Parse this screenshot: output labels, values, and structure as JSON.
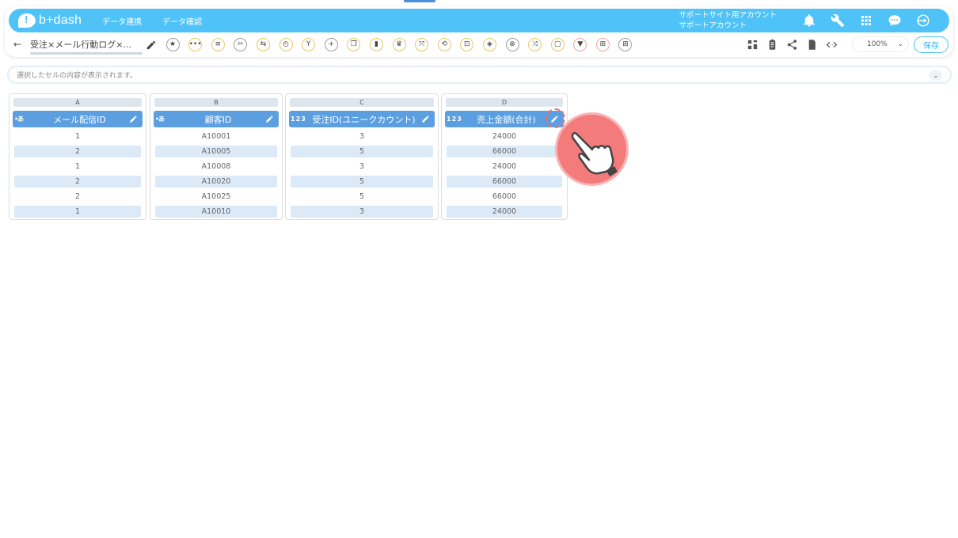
{
  "app": {
    "logo_text": "b+dash",
    "nav": [
      "データ連携",
      "データ確認"
    ],
    "account_line1": "サポートサイト用アカウント",
    "account_line2": "サポートアカウント"
  },
  "header_icons": [
    "bell-icon",
    "wrench-icon",
    "grid-icon",
    "chat-icon",
    "logout-icon"
  ],
  "toolbar": {
    "back_label": "←",
    "doc_title": "受注×メール行動ログ×...",
    "tool_buttons": [
      {
        "name": "star-icon",
        "glyph": "★",
        "tone": "g"
      },
      {
        "name": "more-icon",
        "glyph": "•••",
        "tone": "y"
      },
      {
        "name": "list-icon",
        "glyph": "≡",
        "tone": "y"
      },
      {
        "name": "scissors-icon",
        "glyph": "✂",
        "tone": "g"
      },
      {
        "name": "merge-icon",
        "glyph": "⇆",
        "tone": "y"
      },
      {
        "name": "timer-icon",
        "glyph": "◴",
        "tone": "y"
      },
      {
        "name": "branch-icon",
        "glyph": "Y",
        "tone": "y"
      },
      {
        "name": "plus-icon",
        "glyph": "+",
        "tone": "g"
      },
      {
        "name": "copy-icon",
        "glyph": "❐",
        "tone": "y"
      },
      {
        "name": "trash-icon",
        "glyph": "▮",
        "tone": "y"
      },
      {
        "name": "crown-icon",
        "glyph": "♛",
        "tone": "y"
      },
      {
        "name": "expand-icon",
        "glyph": "⤧",
        "tone": "y"
      },
      {
        "name": "repeat-icon",
        "glyph": "⟲",
        "tone": "y"
      },
      {
        "name": "lock-icon",
        "glyph": "⊡",
        "tone": "y"
      },
      {
        "name": "box-icon",
        "glyph": "◈",
        "tone": "y"
      },
      {
        "name": "cancel-icon",
        "glyph": "⊗",
        "tone": "g"
      },
      {
        "name": "shuffle-icon",
        "glyph": "⤨",
        "tone": "y"
      },
      {
        "name": "frame-icon",
        "glyph": "▢",
        "tone": "y"
      },
      {
        "name": "filter-icon",
        "glyph": "▼",
        "tone": "r"
      },
      {
        "name": "pivot-icon",
        "glyph": "⊞",
        "tone": "r"
      },
      {
        "name": "table-icon",
        "glyph": "⊞",
        "tone": "g"
      }
    ],
    "right_icons": [
      "flow-icon",
      "clipboard-icon",
      "share-icon",
      "history-icon",
      "code-icon"
    ],
    "zoom_value": "100%",
    "zoom_caret": "⌄",
    "save_label": "保存"
  },
  "cellbar": {
    "placeholder": "選択したセルの内容が表示されます。",
    "toggle": "⌄"
  },
  "columns": [
    {
      "letter": "A",
      "type": "a",
      "header": "メール配信ID",
      "cells": [
        "1",
        "2",
        "1",
        "2",
        "2",
        "1"
      ]
    },
    {
      "letter": "B",
      "type": "a",
      "header": "顧客ID",
      "cells": [
        "A10001",
        "A10005",
        "A10008",
        "A10020",
        "A10025",
        "A10010"
      ]
    },
    {
      "letter": "C",
      "type": "123",
      "header": "受注ID(ユニークカウント)",
      "cells": [
        "3",
        "5",
        "3",
        "5",
        "5",
        "3"
      ]
    },
    {
      "letter": "D",
      "type": "123",
      "header": "売上金額(合計)",
      "cells": [
        "24000",
        "66000",
        "24000",
        "66000",
        "66000",
        "24000"
      ]
    }
  ]
}
